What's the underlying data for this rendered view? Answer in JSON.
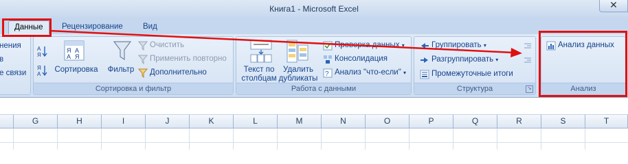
{
  "window": {
    "title": "Книга1 - Microsoft Excel"
  },
  "tabs": [
    {
      "label": "Данные",
      "active": true
    },
    {
      "label": "Рецензирование",
      "active": false
    },
    {
      "label": "Вид",
      "active": false
    }
  ],
  "ribbon": {
    "left_partial": [
      "нения",
      "в",
      "е связи"
    ],
    "sort_filter": {
      "label": "Сортировка и фильтр",
      "sort_label": "Сортировка",
      "filter_label": "Фильтр",
      "clear_label": "Очистить",
      "reapply_label": "Применить повторно",
      "advanced_label": "Дополнительно"
    },
    "data_tools": {
      "label": "Работа с данными",
      "text_to_columns": [
        "Текст по",
        "столбцам"
      ],
      "remove_duplicates": [
        "Удалить",
        "дубликаты"
      ],
      "validation_label": "Проверка данных",
      "consolidate_label": "Консолидация",
      "whatif_label": "Анализ \"что-если\""
    },
    "outline": {
      "label": "Структура",
      "group_label": "Группировать",
      "ungroup_label": "Разгруппировать",
      "subtotal_label": "Промежуточные итоги"
    },
    "analysis": {
      "label": "Анализ",
      "data_analysis_label": "Анализ данных"
    }
  },
  "columns": [
    "G",
    "H",
    "I",
    "J",
    "K",
    "L",
    "M",
    "N",
    "O",
    "P",
    "Q",
    "R",
    "S",
    "T"
  ],
  "colors": {
    "highlight": "#e01010",
    "accent": "#15428b"
  }
}
